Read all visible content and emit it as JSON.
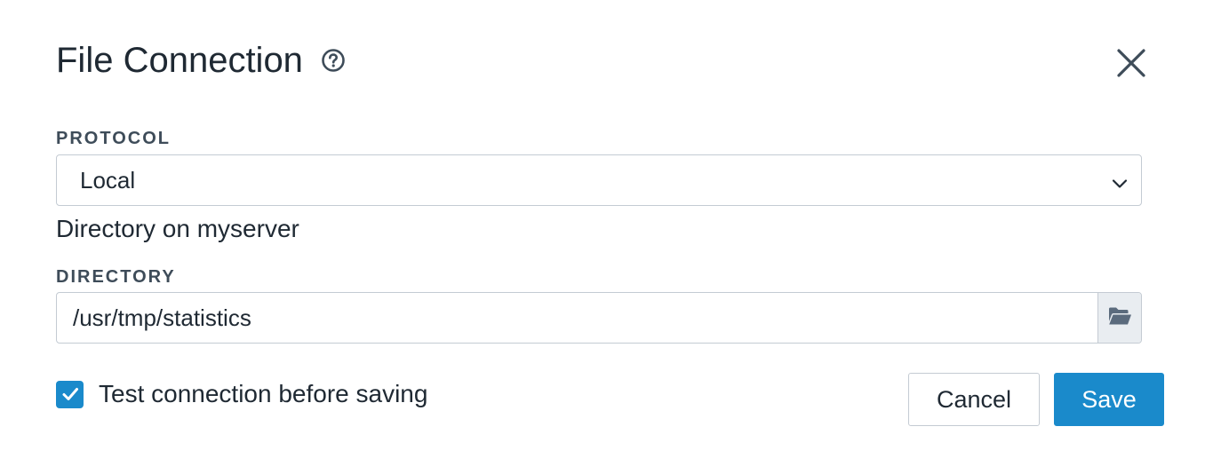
{
  "dialog": {
    "title": "File Connection",
    "help_icon": "help-circle-icon",
    "close_icon": "close-icon"
  },
  "protocol": {
    "label": "PROTOCOL",
    "selected": "Local",
    "description": "Directory on myserver"
  },
  "directory": {
    "label": "DIRECTORY",
    "value": "/usr/tmp/statistics",
    "browse_icon": "folder-open-icon"
  },
  "test_connection": {
    "label": "Test connection before saving",
    "checked": true
  },
  "actions": {
    "cancel_label": "Cancel",
    "save_label": "Save"
  },
  "colors": {
    "accent": "#1a8acb",
    "border": "#c4cbd3",
    "text": "#1f2933",
    "label": "#3e4c59"
  }
}
